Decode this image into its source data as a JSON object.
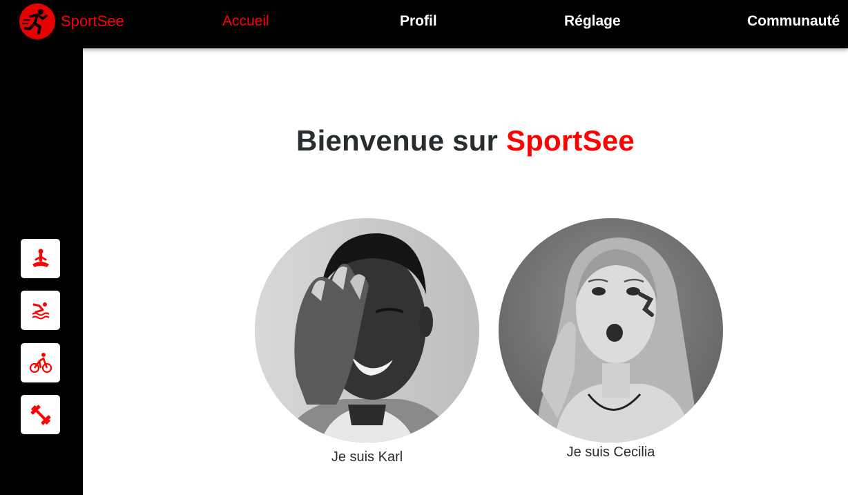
{
  "header": {
    "logo_text": "SportSee",
    "logo_icon": "runner-icon",
    "nav": [
      {
        "label": "Accueil",
        "active": true
      },
      {
        "label": "Profil",
        "active": false
      },
      {
        "label": "Réglage",
        "active": false
      },
      {
        "label": "Communauté",
        "active": false
      }
    ]
  },
  "sidebar": {
    "items": [
      {
        "icon": "meditation-icon"
      },
      {
        "icon": "swimming-icon"
      },
      {
        "icon": "cycling-icon"
      },
      {
        "icon": "dumbbell-icon"
      }
    ]
  },
  "main": {
    "title_prefix": "Bienvenue sur",
    "title_brand": "SportSee",
    "users": [
      {
        "label": "Je suis Karl",
        "photo": "man-covering-eye-photo"
      },
      {
        "label": "Je suis Cecilia",
        "photo": "woman-surprised-photo"
      }
    ]
  },
  "colors": {
    "brand_red": "#ff0101",
    "nav_bg": "#000000",
    "text_dark": "#282d30",
    "card_bg": "#ffffff"
  }
}
